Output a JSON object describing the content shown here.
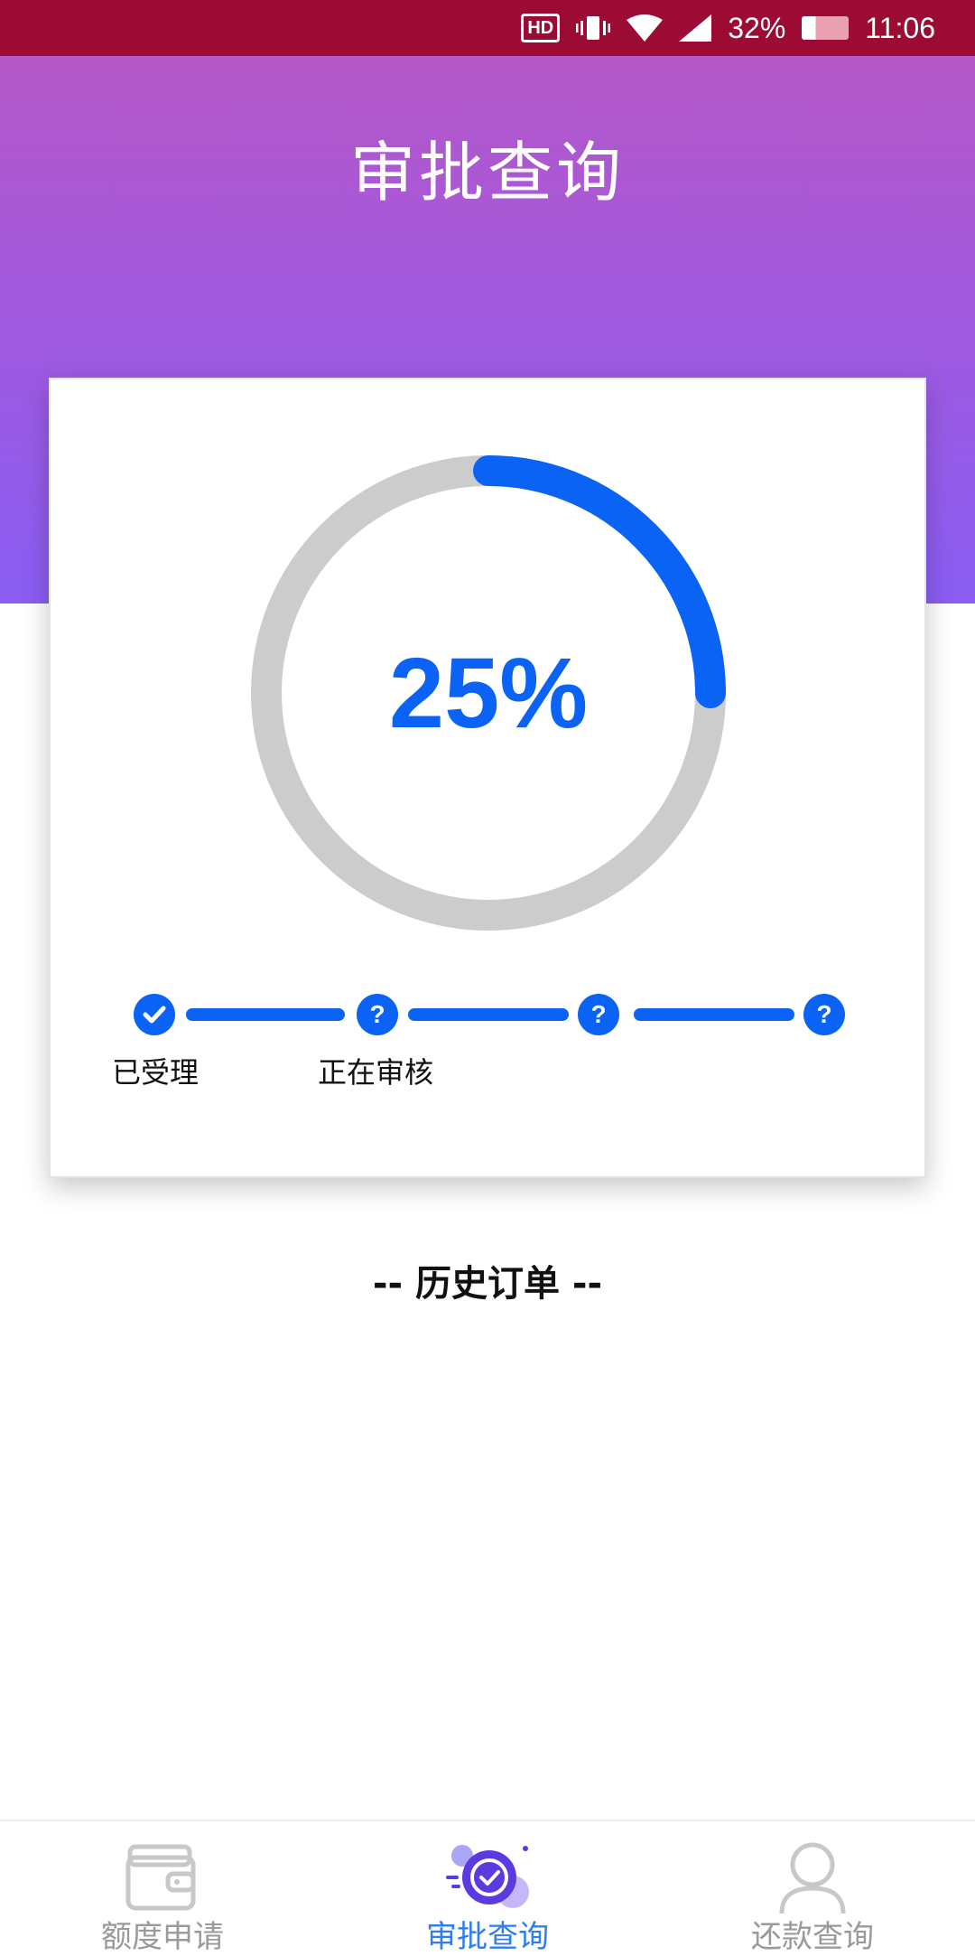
{
  "status_bar": {
    "hd": "HD",
    "battery": "32%",
    "time": "11:06"
  },
  "header": {
    "title": "审批查询"
  },
  "progress": {
    "value": 25,
    "label": "25%",
    "colors": {
      "accent": "#0a63f5",
      "track": "#cccccc"
    }
  },
  "steps": [
    {
      "state": "done",
      "label": "已受理"
    },
    {
      "state": "pending",
      "label": "正在审核"
    },
    {
      "state": "pending",
      "label": ""
    },
    {
      "state": "pending",
      "label": ""
    }
  ],
  "history": {
    "title": "-- 历史订单 --"
  },
  "nav": {
    "items": [
      {
        "label": "额度申请",
        "icon": "wallet-icon",
        "active": false
      },
      {
        "label": "审批查询",
        "icon": "approval-check-icon",
        "active": true
      },
      {
        "label": "还款查询",
        "icon": "user-icon",
        "active": false
      }
    ]
  }
}
